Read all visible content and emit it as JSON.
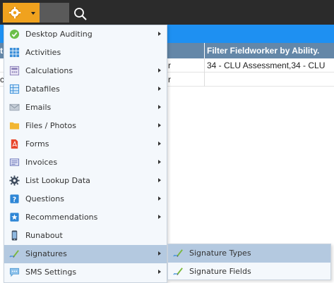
{
  "grid": {
    "header_col2": "Filter Fieldworker by Ability.",
    "header_col0_fragment": "t",
    "rows": [
      {
        "col0_fragment": "",
        "col1_fragment": "r",
        "col2": "34 - CLU Assessment,34 - CLU"
      },
      {
        "col0_fragment": "c",
        "col1_fragment": "r",
        "col2": ""
      }
    ]
  },
  "menu": {
    "items": [
      {
        "label": "Desktop Auditing",
        "icon": "check-circle-icon",
        "has_submenu": true
      },
      {
        "label": "Activities",
        "icon": "grid-icon",
        "has_submenu": false
      },
      {
        "label": "Calculations",
        "icon": "calculator-icon",
        "has_submenu": true
      },
      {
        "label": "Datafiles",
        "icon": "table-icon",
        "has_submenu": true
      },
      {
        "label": "Emails",
        "icon": "envelope-icon",
        "has_submenu": true
      },
      {
        "label": "Files / Photos",
        "icon": "folder-icon",
        "has_submenu": true
      },
      {
        "label": "Forms",
        "icon": "pdf-icon",
        "has_submenu": true
      },
      {
        "label": "Invoices",
        "icon": "invoice-icon",
        "has_submenu": true
      },
      {
        "label": "List Lookup Data",
        "icon": "gear-icon",
        "has_submenu": true
      },
      {
        "label": "Questions",
        "icon": "question-icon",
        "has_submenu": true
      },
      {
        "label": "Recommendations",
        "icon": "star-icon",
        "has_submenu": true
      },
      {
        "label": "Runabout",
        "icon": "phone-icon",
        "has_submenu": false
      },
      {
        "label": "Signatures",
        "icon": "signature-icon",
        "has_submenu": true,
        "active": true
      },
      {
        "label": "SMS Settings",
        "icon": "sms-icon",
        "has_submenu": true
      }
    ]
  },
  "submenu": {
    "items": [
      {
        "label": "Signature Types",
        "icon": "signature-icon",
        "active": true
      },
      {
        "label": "Signature Fields",
        "icon": "signature-icon"
      }
    ]
  },
  "colors": {
    "toolbar": "#2b2b2b",
    "gear_button": "#f0a21e",
    "blue_band": "#1e90f2",
    "grid_header": "#6487a8",
    "menu_bg": "#f4f8fc",
    "menu_active": "#b4c9e0"
  }
}
